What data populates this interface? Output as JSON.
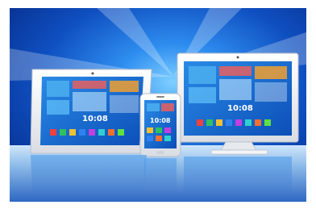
{
  "scene": {
    "devices": [
      "tablet",
      "smartphone",
      "desktop-monitor"
    ],
    "colors": {
      "background_top": "#0a3ea8",
      "background_glow": "#3fa8f4",
      "floor": "#9ec4e8",
      "device_frame": "#f2f3f5",
      "screen_bg": "#1a6fd0"
    }
  },
  "tablet": {
    "clock": "10:08"
  },
  "monitor": {
    "clock": "10:08"
  },
  "phone": {
    "clock": "10:08"
  }
}
